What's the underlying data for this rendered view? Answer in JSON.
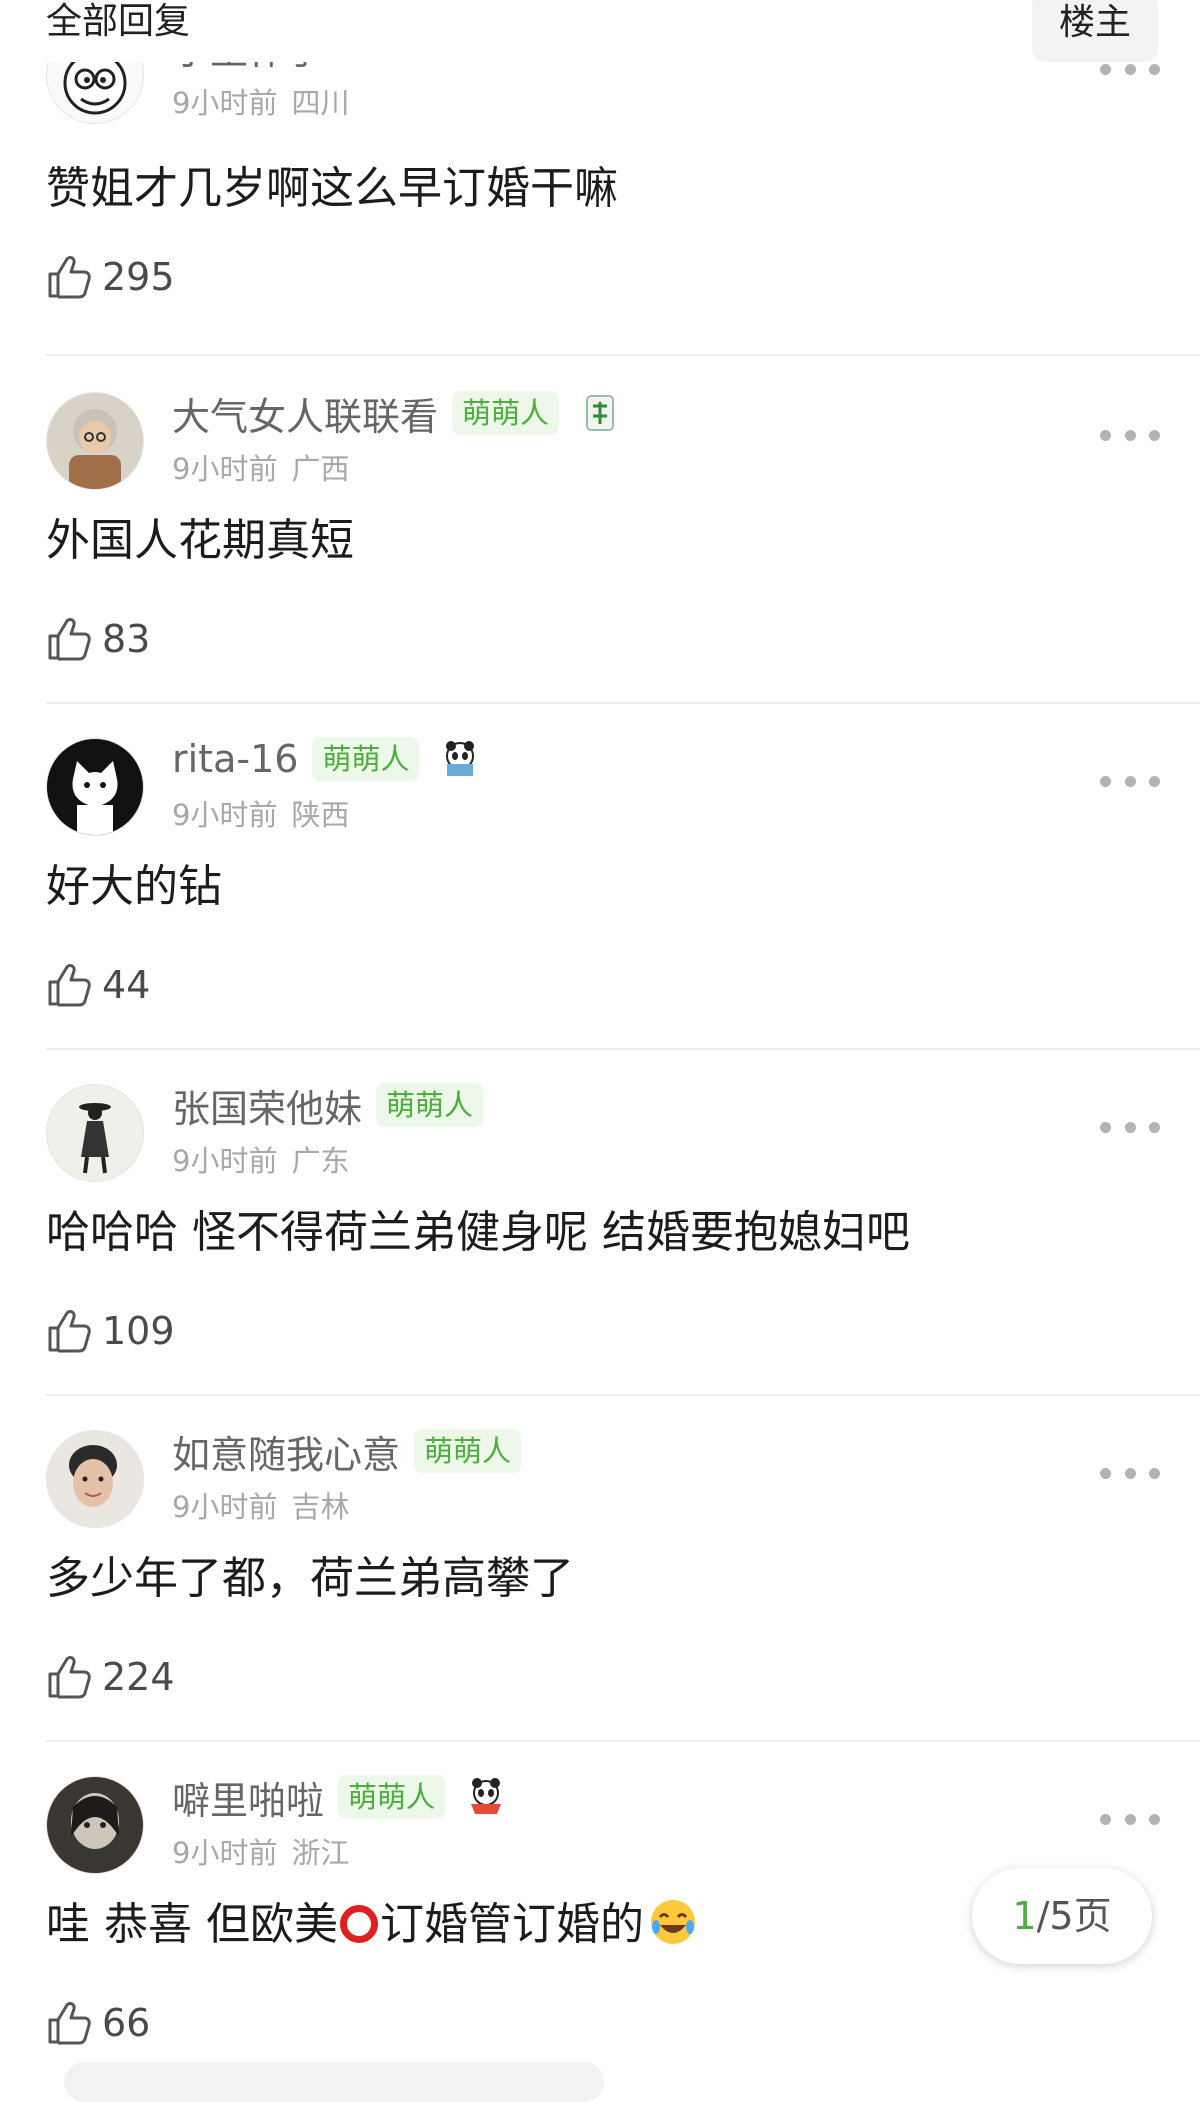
{
  "header": {
    "title": "全部回复",
    "op_button": "楼主"
  },
  "comments": [
    {
      "username": "小王作手",
      "badge": "",
      "time": "9小时前",
      "location": "四川",
      "text": "赞姐才几岁啊这么早订婚干嘛",
      "likes": "295",
      "avatar_icon": "cartoon-face-avatar",
      "mini_icon": "red-card-icon"
    },
    {
      "username": "大气女人联联看",
      "badge": "萌萌人",
      "time": "9小时前",
      "location": "广西",
      "text": "外国人花期真短",
      "likes": "83",
      "avatar_icon": "grandma-avatar",
      "mini_icon": "mahjong-fa-tile-icon"
    },
    {
      "username": "rita-16",
      "badge": "萌萌人",
      "time": "9小时前",
      "location": "陕西",
      "text": "好大的钻",
      "likes": "44",
      "avatar_icon": "cat-avatar",
      "mini_icon": "panda-reading-icon"
    },
    {
      "username": "张国荣他妹",
      "badge": "萌萌人",
      "time": "9小时前",
      "location": "广东",
      "text": "哈哈哈 怪不得荷兰弟健身呢 结婚要抱媳妇吧",
      "likes": "109",
      "avatar_icon": "figure-avatar",
      "mini_icon": ""
    },
    {
      "username": "如意随我心意",
      "badge": "萌萌人",
      "time": "9小时前",
      "location": "吉林",
      "text": "多少年了都，荷兰弟高攀了",
      "likes": "224",
      "avatar_icon": "photo-avatar",
      "mini_icon": ""
    },
    {
      "username": "噼里啪啦",
      "badge": "萌萌人",
      "time": "9小时前",
      "location": "浙江",
      "text_before": "哇 恭喜 但欧美",
      "text_after": "订婚管订婚的",
      "likes": "66",
      "avatar_icon": "sketch-avatar",
      "mini_icon": "panda-bowl-icon"
    }
  ],
  "pager": {
    "current": "1",
    "rest": "/5页"
  },
  "colors": {
    "accent_green": "#4cae3c",
    "badge_bg": "#eef8ea",
    "meta_gray": "#a8a8a8"
  }
}
